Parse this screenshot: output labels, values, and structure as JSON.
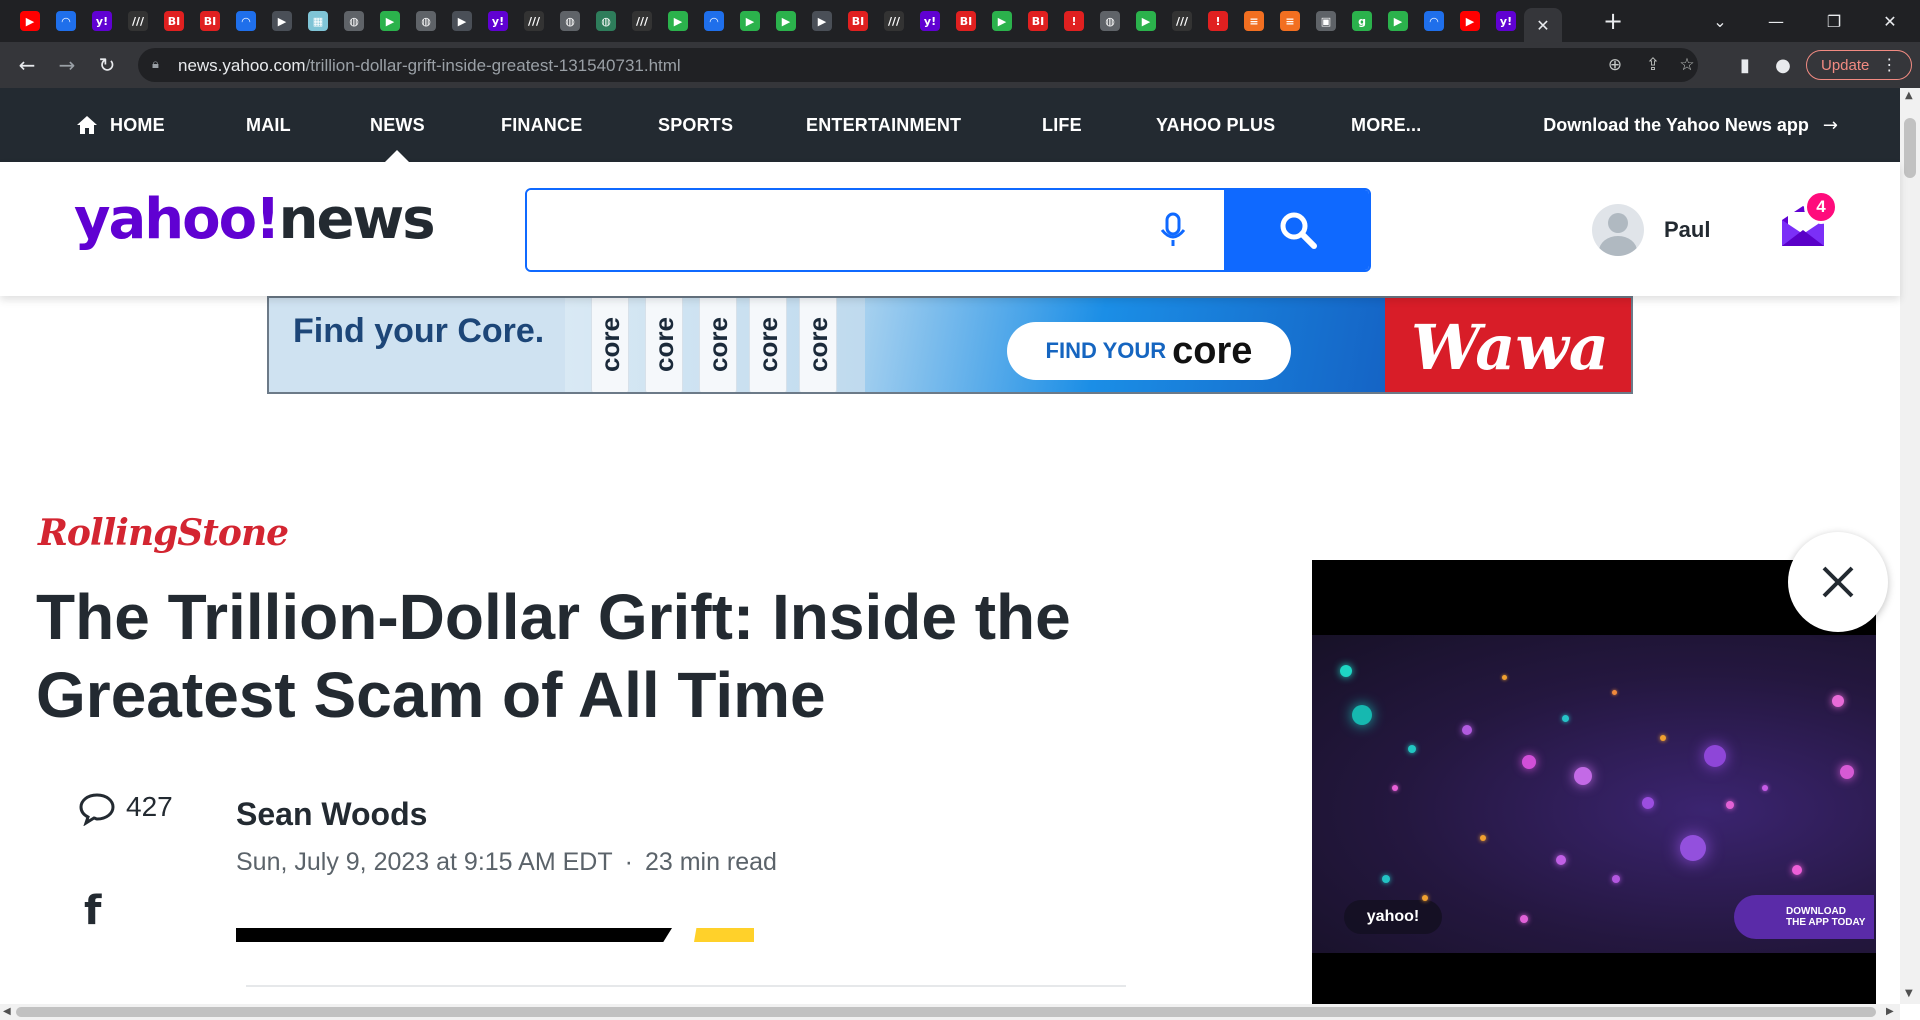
{
  "browser": {
    "tabs": [
      {
        "icon": "youtube-icon",
        "color": "#ff0000",
        "glyph": "▶"
      },
      {
        "icon": "shield-icon",
        "color": "#1f6feb",
        "glyph": "◠"
      },
      {
        "icon": "yahoo-icon",
        "color": "#6001d2",
        "glyph": "y!"
      },
      {
        "icon": "wsj-icon",
        "color": "#333333",
        "glyph": "///"
      },
      {
        "icon": "business-insider-icon",
        "color": "#e02020",
        "glyph": "BI"
      },
      {
        "icon": "business-insider-icon",
        "color": "#e02020",
        "glyph": "BI"
      },
      {
        "icon": "shield-icon",
        "color": "#1f6feb",
        "glyph": "◠"
      },
      {
        "icon": "feedly-icon",
        "color": "#4a4f57",
        "glyph": "▶"
      },
      {
        "icon": "image-icon",
        "color": "#7fc4d6",
        "glyph": "▦"
      },
      {
        "icon": "globe-icon",
        "color": "#5f6368",
        "glyph": "◍"
      },
      {
        "icon": "play-icon",
        "color": "#2bb24c",
        "glyph": "▶"
      },
      {
        "icon": "globe-icon",
        "color": "#5f6368",
        "glyph": "◍"
      },
      {
        "icon": "feedly-icon",
        "color": "#4a4f57",
        "glyph": "▶"
      },
      {
        "icon": "yahoo-icon",
        "color": "#6001d2",
        "glyph": "y!"
      },
      {
        "icon": "wsj-icon",
        "color": "#333333",
        "glyph": "///"
      },
      {
        "icon": "globe-icon",
        "color": "#5f6368",
        "glyph": "◍"
      },
      {
        "icon": "globe-icon",
        "color": "#2e7d5b",
        "glyph": "◍"
      },
      {
        "icon": "wsj-icon",
        "color": "#333333",
        "glyph": "///"
      },
      {
        "icon": "play-icon",
        "color": "#2bb24c",
        "glyph": "▶"
      },
      {
        "icon": "shield-icon",
        "color": "#1f6feb",
        "glyph": "◠"
      },
      {
        "icon": "play-icon",
        "color": "#2bb24c",
        "glyph": "▶"
      },
      {
        "icon": "play-icon",
        "color": "#2bb24c",
        "glyph": "▶"
      },
      {
        "icon": "feedly-icon",
        "color": "#4a4f57",
        "glyph": "▶"
      },
      {
        "icon": "business-insider-icon",
        "color": "#e02020",
        "glyph": "BI"
      },
      {
        "icon": "wsj-icon",
        "color": "#333333",
        "glyph": "///"
      },
      {
        "icon": "yahoo-icon",
        "color": "#6001d2",
        "glyph": "y!"
      },
      {
        "icon": "business-insider-icon",
        "color": "#e02020",
        "glyph": "BI"
      },
      {
        "icon": "play-icon",
        "color": "#2bb24c",
        "glyph": "▶"
      },
      {
        "icon": "business-insider-icon",
        "color": "#e02020",
        "glyph": "BI"
      },
      {
        "icon": "microphone-icon",
        "color": "#e02020",
        "glyph": "!"
      },
      {
        "icon": "globe-icon",
        "color": "#5f6368",
        "glyph": "◍"
      },
      {
        "icon": "play-icon",
        "color": "#2bb24c",
        "glyph": "▶"
      },
      {
        "icon": "wsj-icon",
        "color": "#333333",
        "glyph": "///"
      },
      {
        "icon": "microphone-icon",
        "color": "#e02020",
        "glyph": "!"
      },
      {
        "icon": "bookmark-icon",
        "color": "#f26f21",
        "glyph": "≡"
      },
      {
        "icon": "bookmark-icon",
        "color": "#f26f21",
        "glyph": "≡"
      },
      {
        "icon": "lock-icon",
        "color": "#5f6368",
        "glyph": "▣"
      },
      {
        "icon": "g-icon",
        "color": "#2bb24c",
        "glyph": "g"
      },
      {
        "icon": "play-icon",
        "color": "#2bb24c",
        "glyph": "▶"
      },
      {
        "icon": "shield-icon",
        "color": "#1f6feb",
        "glyph": "◠"
      },
      {
        "icon": "youtube-icon",
        "color": "#ff0000",
        "glyph": "▶"
      },
      {
        "icon": "yahoo-icon",
        "color": "#6001d2",
        "glyph": "y!"
      }
    ],
    "active_tab_close": "✕",
    "new_tab": "+",
    "url_host": "news.yahoo.com",
    "url_path": "/trillion-dollar-grift-inside-greatest-131540731.html",
    "update_label": "Update"
  },
  "nav": {
    "items": [
      {
        "label": "HOME",
        "name": "nav-home"
      },
      {
        "label": "MAIL",
        "name": "nav-mail"
      },
      {
        "label": "NEWS",
        "name": "nav-news"
      },
      {
        "label": "FINANCE",
        "name": "nav-finance"
      },
      {
        "label": "SPORTS",
        "name": "nav-sports"
      },
      {
        "label": "ENTERTAINMENT",
        "name": "nav-entertainment"
      },
      {
        "label": "LIFE",
        "name": "nav-life"
      },
      {
        "label": "YAHOO PLUS",
        "name": "nav-yahoo-plus"
      },
      {
        "label": "MORE...",
        "name": "nav-more"
      }
    ],
    "active": "NEWS",
    "app_link": "Download the Yahoo News app"
  },
  "header": {
    "logo_yahoo": "yahoo!",
    "logo_news": "news",
    "search_placeholder": "",
    "user_name": "Paul",
    "mail_count": "4"
  },
  "ad": {
    "headline": "Find your Core.",
    "bottle_label": "core",
    "cta_prefix": "FIND YOUR",
    "cta_brand": "core",
    "sponsor": "Wawa"
  },
  "article": {
    "publisher": "RollingStone",
    "title": "The Trillion-Dollar Grift: Inside the Greatest Scam of All Time",
    "comment_count": "427",
    "author": "Sean Woods",
    "date": "Sun, July 9, 2023 at 9:15 AM EDT",
    "separator": "·",
    "read_time": "23 min read"
  },
  "video": {
    "badge": "yahoo!",
    "app_line1": "DOWNLOAD",
    "app_line2": "THE APP TODAY"
  },
  "colors": {
    "yahoo_purple": "#6001d2",
    "nav_bg": "#232a31",
    "search_blue": "#0f69ff",
    "badge_pink": "#ff0b7c",
    "publisher_red": "#d32531"
  }
}
